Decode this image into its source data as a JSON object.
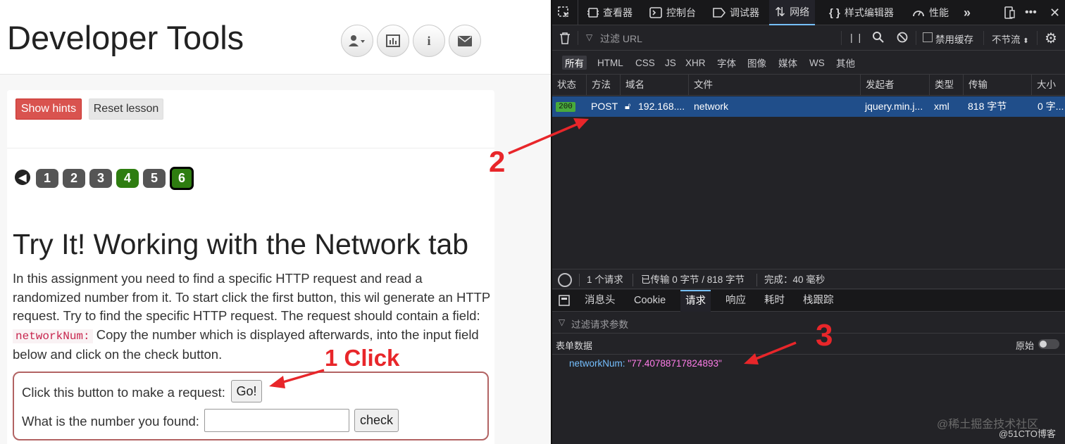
{
  "left": {
    "app_title": "Developer Tools",
    "header_icons": [
      "user-dropdown-icon",
      "bar-chart-icon",
      "info-icon",
      "envelope-icon"
    ],
    "show_hints_label": "Show hints",
    "reset_lesson_label": "Reset lesson",
    "pages": [
      "1",
      "2",
      "3",
      "4",
      "5",
      "6"
    ],
    "lesson_title": "Try It! Working with the Network tab",
    "desc_part1": "In this assignment you need to find a specific HTTP request and read a randomized number from it. To start click the first button, this wil generate an HTTP request. Try to find the specific HTTP request. The request should contain a field: ",
    "desc_code": "networkNum:",
    "desc_part2": " Copy the number which is displayed afterwards, into the input field below and click on the check button.",
    "request_label": "Click this button to make a request:",
    "go_label": "Go!",
    "number_label": "What is the number you found:",
    "number_value": "",
    "check_label": "check"
  },
  "devtools": {
    "tabs": [
      "查看器",
      "控制台",
      "调试器",
      "网络",
      "样式编辑器",
      "性能"
    ],
    "filter_placeholder": "过滤 URL",
    "disable_cache_label": "禁用缓存",
    "throttle_label": "不节流",
    "types": [
      "所有",
      "HTML",
      "CSS",
      "JS",
      "XHR",
      "字体",
      "图像",
      "媒体",
      "WS",
      "其他"
    ],
    "columns": [
      "状态",
      "方法",
      "域名",
      "文件",
      "发起者",
      "类型",
      "传输",
      "大小"
    ],
    "request": {
      "status": "200",
      "method": "POST",
      "domain": "192.168....",
      "file": "network",
      "initiator": "jquery.min.j...",
      "type": "xml",
      "transferred": "818 字节",
      "size": "0 字..."
    },
    "summary": {
      "requests": "1 个请求",
      "transferred": "已传输 0 字节 / 818 字节",
      "finished": "完成：40 毫秒"
    },
    "subtabs": [
      "消息头",
      "Cookie",
      "请求",
      "响应",
      "耗时",
      "栈跟踪"
    ],
    "param_filter_placeholder": "过滤请求参数",
    "form_data_label": "表单数据",
    "raw_label": "原始",
    "param_key": "networkNum",
    "param_value": "\"77.40788717824893\""
  },
  "annotations": {
    "click_label": "1 Click",
    "label_2": "2",
    "label_3": "3"
  },
  "watermark": "@稀土掘金技术社区",
  "watermark2": "@51CTO博客",
  "colors": {
    "hint_red": "#d9534f",
    "page_green": "#2e7d10",
    "selected_row": "#204e8a",
    "annotation_red": "#e8262a",
    "param_value": "#ff7de9",
    "param_key": "#75bfff"
  }
}
